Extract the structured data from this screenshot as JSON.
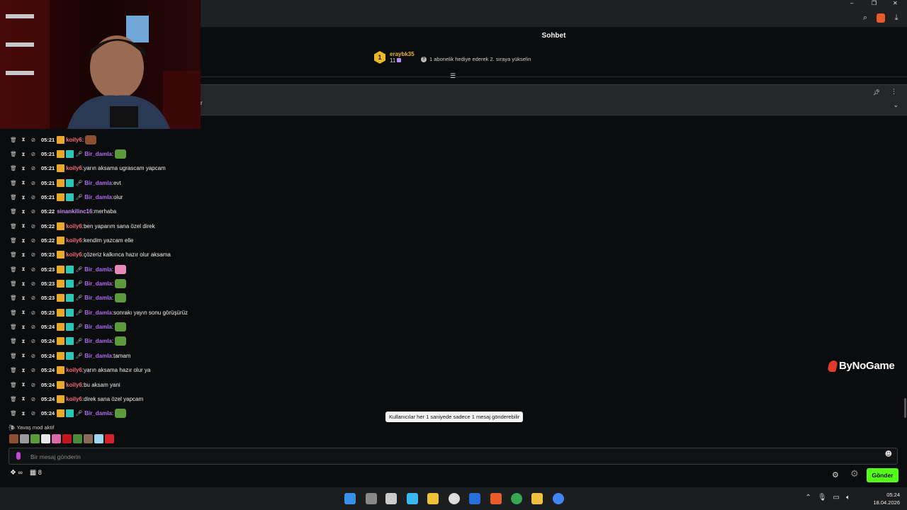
{
  "header": {
    "title": "Sohbet"
  },
  "top_gifter": {
    "rank": "1",
    "name": "eraybk35",
    "count": "11",
    "message": "1 abonelik hediye ederek 2. sıraya yükselin"
  },
  "pinned": {
    "text": "r"
  },
  "messages": [
    {
      "time": "05:21",
      "user": "koily6",
      "color": "#f26a7a",
      "badges": [
        "gold"
      ],
      "text": "",
      "emote": "brown"
    },
    {
      "time": "05:21",
      "user": "Bir_damla",
      "color": "#b06cf0",
      "badges": [
        "gold",
        "teal",
        "mic"
      ],
      "text": "",
      "emote": "frog"
    },
    {
      "time": "05:21",
      "user": "koily6",
      "color": "#f26a7a",
      "badges": [
        "gold"
      ],
      "text": "yarın aksama ugrascam yapcam",
      "emote": ""
    },
    {
      "time": "05:21",
      "user": "Bir_damla",
      "color": "#b06cf0",
      "badges": [
        "gold",
        "teal",
        "mic"
      ],
      "text": "evt",
      "emote": ""
    },
    {
      "time": "05:21",
      "user": "Bir_damla",
      "color": "#b06cf0",
      "badges": [
        "gold",
        "teal",
        "mic"
      ],
      "text": "olur",
      "emote": ""
    },
    {
      "time": "05:22",
      "user": "sinankilinc16",
      "color": "#c48cf5",
      "badges": [],
      "text": "merhaba",
      "emote": ""
    },
    {
      "time": "05:22",
      "user": "koily6",
      "color": "#f26a7a",
      "badges": [
        "gold"
      ],
      "text": "ben yaparım sana özel direk",
      "emote": ""
    },
    {
      "time": "05:22",
      "user": "koily6",
      "color": "#f26a7a",
      "badges": [
        "gold"
      ],
      "text": "kendim yazcam elle",
      "emote": ""
    },
    {
      "time": "05:23",
      "user": "koily6",
      "color": "#f26a7a",
      "badges": [
        "gold"
      ],
      "text": "çözeriz kalkınca hazır olur aksama",
      "emote": ""
    },
    {
      "time": "05:23",
      "user": "Bir_damla",
      "color": "#b06cf0",
      "badges": [
        "gold",
        "teal",
        "mic"
      ],
      "text": "",
      "emote": "hearts"
    },
    {
      "time": "05:23",
      "user": "Bir_damla",
      "color": "#b06cf0",
      "badges": [
        "gold",
        "teal",
        "mic"
      ],
      "text": "",
      "emote": "frog"
    },
    {
      "time": "05:23",
      "user": "Bir_damla",
      "color": "#b06cf0",
      "badges": [
        "gold",
        "teal",
        "mic"
      ],
      "text": "",
      "emote": "frog"
    },
    {
      "time": "05:23",
      "user": "Bir_damla",
      "color": "#b06cf0",
      "badges": [
        "gold",
        "teal",
        "mic"
      ],
      "text": "sonrakı yayın sonu görüşürüz",
      "emote": ""
    },
    {
      "time": "05:24",
      "user": "Bir_damla",
      "color": "#b06cf0",
      "badges": [
        "gold",
        "teal",
        "mic"
      ],
      "text": "",
      "emote": "frog"
    },
    {
      "time": "05:24",
      "user": "Bir_damla",
      "color": "#b06cf0",
      "badges": [
        "gold",
        "teal",
        "mic"
      ],
      "text": "",
      "emote": "frog"
    },
    {
      "time": "05:24",
      "user": "Bir_damla",
      "color": "#b06cf0",
      "badges": [
        "gold",
        "teal",
        "mic"
      ],
      "text": "tamam",
      "emote": ""
    },
    {
      "time": "05:24",
      "user": "koily6",
      "color": "#f26a7a",
      "badges": [
        "gold"
      ],
      "text": "yarın aksama hazır olur ya",
      "emote": ""
    },
    {
      "time": "05:24",
      "user": "koily6",
      "color": "#f26a7a",
      "badges": [
        "gold"
      ],
      "text": "bu aksam yani",
      "emote": ""
    },
    {
      "time": "05:24",
      "user": "koily6",
      "color": "#f26a7a",
      "badges": [
        "gold"
      ],
      "text": "direk sana özel yapcam",
      "emote": ""
    },
    {
      "time": "05:24",
      "user": "Bir_damla",
      "color": "#b06cf0",
      "badges": [
        "gold",
        "teal",
        "mic"
      ],
      "text": "",
      "emote": "frog"
    }
  ],
  "slow_mode": "Yavaş mod aktif",
  "input": {
    "placeholder": "Bir mesaj gönderin"
  },
  "tooltip": "Kullanıcılar her 1 saniyede sadece 1 mesaj gönderebilir",
  "logo": "ByNoGame",
  "bottom": {
    "infinity": "∞",
    "count": "8"
  },
  "send_label": "Gönder",
  "clock": {
    "time": "05:24",
    "date": "18.04.2026"
  },
  "colors": {
    "accent": "#53fc18",
    "gold": "#e8b82a"
  },
  "taskbar_apps": [
    "windows-start-icon",
    "task-view-icon",
    "app-icon",
    "photos-icon",
    "file-explorer-icon",
    "obs-icon",
    "steam-icon",
    "brave-icon",
    "chrome-icon",
    "media-icon",
    "chrome-icon"
  ]
}
